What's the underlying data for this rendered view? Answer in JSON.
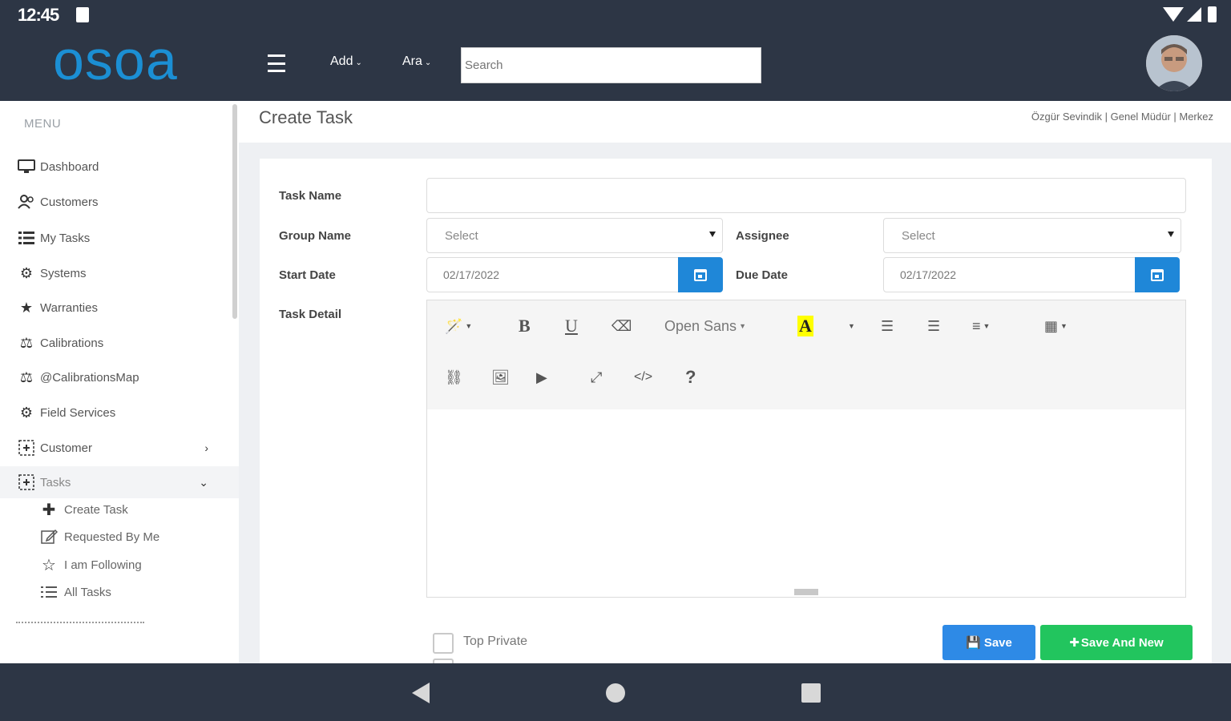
{
  "status_bar": {
    "time": "12:45"
  },
  "header": {
    "logo": "osoa",
    "nav": [
      {
        "label": "Add"
      },
      {
        "label": "Ara"
      }
    ],
    "search_placeholder": "Search"
  },
  "sidebar": {
    "heading": "MENU",
    "items": [
      {
        "label": "Dashboard",
        "icon": "monitor-icon"
      },
      {
        "label": "Customers",
        "icon": "users-icon"
      },
      {
        "label": "My Tasks",
        "icon": "list-icon"
      },
      {
        "label": "Systems",
        "icon": "gear-icon"
      },
      {
        "label": "Warranties",
        "icon": "star-icon"
      },
      {
        "label": "Calibrations",
        "icon": "scale-icon"
      },
      {
        "label": "@CalibrationsMap",
        "icon": "scale-icon"
      },
      {
        "label": "Field Services",
        "icon": "gears-icon"
      },
      {
        "label": "Customer",
        "icon": "plus-box-icon",
        "expandable": true
      },
      {
        "label": "Tasks",
        "icon": "plus-box-icon",
        "expanded": true
      }
    ],
    "sub_items": [
      {
        "label": "Create Task",
        "icon": "plus-icon"
      },
      {
        "label": "Requested By Me",
        "icon": "edit-icon"
      },
      {
        "label": "I am Following",
        "icon": "star-outline-icon"
      },
      {
        "label": "All Tasks",
        "icon": "list-icon"
      }
    ]
  },
  "page": {
    "title": "Create Task",
    "user_info": "Özgür Sevindik | Genel Müdür | Merkez"
  },
  "form": {
    "task_name": {
      "label": "Task Name",
      "value": ""
    },
    "group_name": {
      "label": "Group Name",
      "value": "Select"
    },
    "assignee": {
      "label": "Assignee",
      "value": "Select"
    },
    "start_date": {
      "label": "Start Date",
      "value": "02/17/2022"
    },
    "due_date": {
      "label": "Due Date",
      "value": "02/17/2022"
    },
    "task_detail": {
      "label": "Task Detail"
    },
    "editor_font": "Open Sans",
    "checkbox_top_private": {
      "label": "Top Private",
      "checked": false
    },
    "save_label": "Save",
    "save_new_label": "Save And New"
  },
  "colors": {
    "header_bg": "#2d3645",
    "logo": "#1b8fd4",
    "primary": "#1f87d8",
    "success": "#22c55e"
  }
}
